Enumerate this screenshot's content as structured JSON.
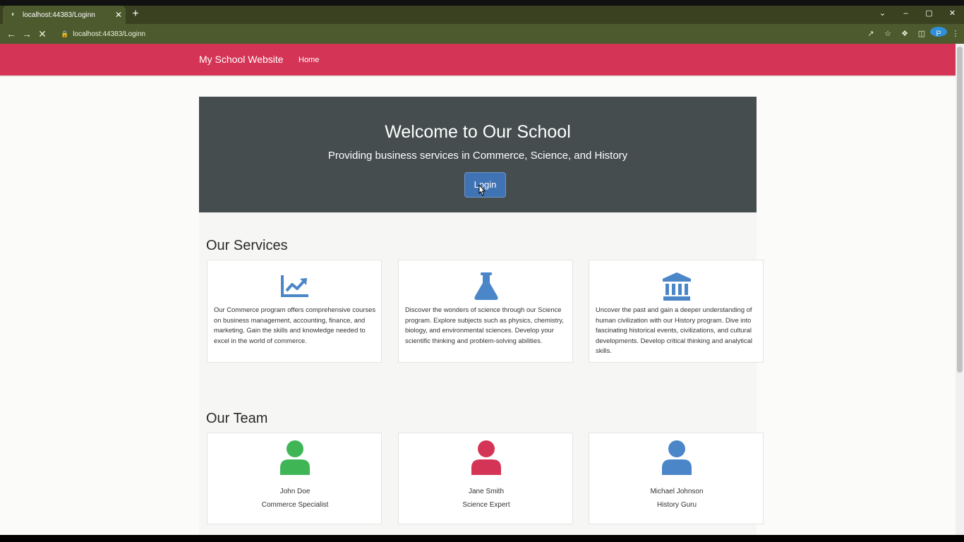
{
  "browser": {
    "tab_title": "localhost:44383/Loginn",
    "tab_close": "✕",
    "new_tab": "+",
    "url": "localhost:44383/Loginn",
    "window_controls": [
      "⌄",
      "–",
      "▢",
      "✕"
    ]
  },
  "navbar": {
    "brand": "My School Website",
    "home": "Home",
    "color": "#d43556"
  },
  "hero": {
    "title": "Welcome to Our School",
    "subtitle": "Providing business services in Commerce, Science, and History",
    "login_label": "Login"
  },
  "services": {
    "title": "Our Services",
    "items": [
      {
        "icon": "chart-line-icon",
        "color": "#4a86c8",
        "text": "Our Commerce program offers comprehensive courses on business management, accounting, finance, and marketing. Gain the skills and knowledge needed to excel in the world of commerce."
      },
      {
        "icon": "flask-icon",
        "color": "#4a86c8",
        "text": "Discover the wonders of science through our Science program. Explore subjects such as physics, chemistry, biology, and environmental sciences. Develop your scientific thinking and problem-solving abilities."
      },
      {
        "icon": "landmark-icon",
        "color": "#4a86c8",
        "text": "Uncover the past and gain a deeper understanding of human civilization with our History program. Dive into fascinating historical events, civilizations, and cultural developments. Develop critical thinking and analytical skills."
      }
    ]
  },
  "team": {
    "title": "Our Team",
    "members": [
      {
        "name": "John Doe",
        "role": "Commerce Specialist",
        "color": "#3fb556"
      },
      {
        "name": "Jane Smith",
        "role": "Science Expert",
        "color": "#d43556"
      },
      {
        "name": "Michael Johnson",
        "role": "History Guru",
        "color": "#4a86c8"
      }
    ]
  }
}
